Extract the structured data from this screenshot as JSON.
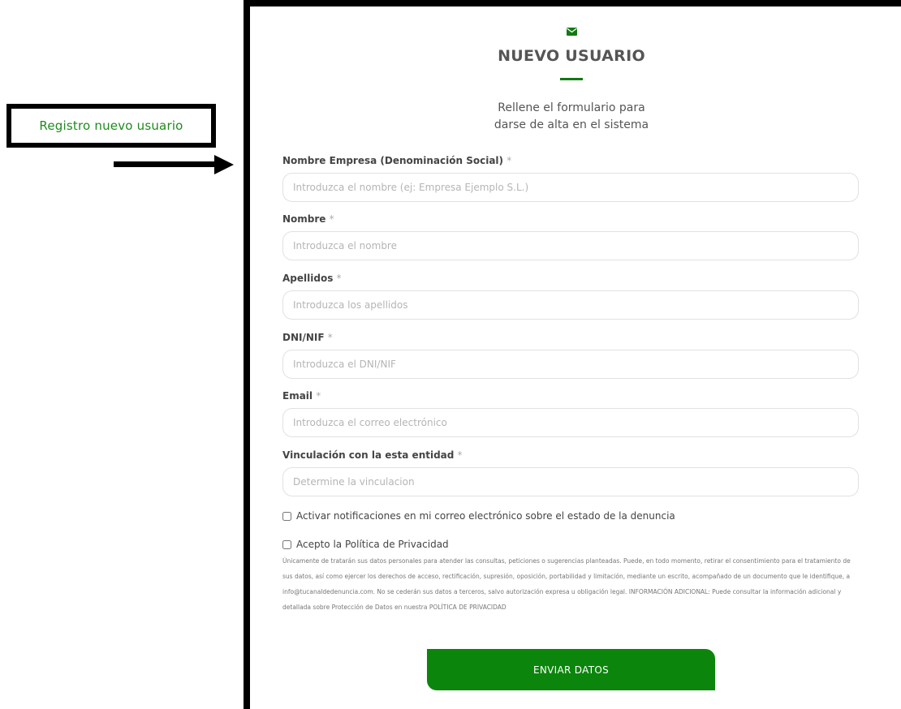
{
  "callout": {
    "label": "Registro nuevo usuario"
  },
  "header": {
    "icon": "envelope-icon",
    "title": "NUEVO USUARIO",
    "subtitle_line1": "Rellene el formulario para",
    "subtitle_line2": "darse de alta en el sistema"
  },
  "fields": [
    {
      "label": "Nombre Empresa (Denominación Social)",
      "required": "*",
      "placeholder": "Introduzca el nombre (ej: Empresa Ejemplo S.L.)",
      "value": ""
    },
    {
      "label": "Nombre",
      "required": "*",
      "placeholder": "Introduzca el nombre",
      "value": ""
    },
    {
      "label": "Apellidos",
      "required": "*",
      "placeholder": "Introduzca los apellidos",
      "value": ""
    },
    {
      "label": "DNI/NIF",
      "required": "*",
      "placeholder": "Introduzca el DNI/NIF",
      "value": ""
    },
    {
      "label": "Email",
      "required": "*",
      "placeholder": "Introduzca el correo electrónico",
      "value": ""
    },
    {
      "label": "Vinculación con la esta entidad",
      "required": "*",
      "placeholder": "Determine la vinculacion",
      "value": ""
    }
  ],
  "checks": {
    "notifications": "Activar notificaciones en mi correo electrónico sobre el estado de la denuncia",
    "privacy": "Acepto la Política de Privacidad"
  },
  "legal_text": "Únicamente de tratarán sus datos personales para atender las consultas, peticiones o sugerencias planteadas. Puede, en todo momento, retirar el consentimiento para el tratamiento de sus datos, así como ejercer los derechos de acceso, rectificación, supresión, oposición, portabilidad y limitación, mediante un escrito, acompañado de un documento que le identifique, a info@tucanaldedenuncia.com. No se cederán sus datos a terceros, salvo autorización expresa u obligación legal. INFORMACIÓN ADICIONAL: Puede consultar la información adicional y detallada sobre Protección de Datos en nuestra POLÍTICA DE PRIVACIDAD",
  "submit": {
    "label": "ENVIAR DATOS"
  },
  "colors": {
    "accent": "#0c850c",
    "callout_text": "#1e8a1e",
    "frame": "#000000"
  }
}
